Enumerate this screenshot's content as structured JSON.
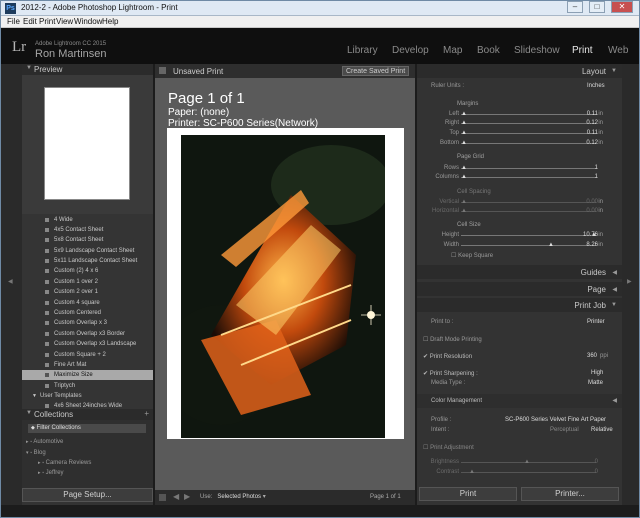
{
  "window": {
    "title": "2012-2 - Adobe Photoshop Lightroom - Print",
    "app_icon": "Ps"
  },
  "menu": [
    "File",
    "Edit",
    "Print",
    "View",
    "Window",
    "Help"
  ],
  "identity": {
    "logo": "Lr",
    "product": "Adobe Lightroom CC 2015",
    "owner": "Ron Martinsen"
  },
  "modules": [
    "Library",
    "Develop",
    "Map",
    "Book",
    "Slideshow",
    "Print",
    "Web"
  ],
  "active_module": "Print",
  "left": {
    "preview_title": "Preview",
    "templates": [
      "4 Wide",
      "4x5 Contact Sheet",
      "5x8 Contact Sheet",
      "5x9 Landscape Contact Sheet",
      "5x11 Landscape Contact Sheet",
      "Custom (2) 4 x 6",
      "Custom 1 over 2",
      "Custom 2 over 1",
      "Custom 4 square",
      "Custom Centered",
      "Custom Overlap x 3",
      "Custom Overlap x3 Border",
      "Custom Overlap x3 Landscape",
      "Custom Square + 2",
      "Fine Art Mat",
      "Maximize Size",
      "Triptych"
    ],
    "selected_template": "Maximize Size",
    "user_templates": "User Templates",
    "user_template_items": [
      "4x6 Sheet 24inches Wide"
    ],
    "collections_title": "Collections",
    "filter_collections": "Filter Collections",
    "collection_items": [
      "Automotive",
      "Blog",
      "Camera Reviews",
      "Jeffrey"
    ],
    "page_setup": "Page Setup..."
  },
  "center": {
    "header_title": "Unsaved Print",
    "create_saved": "Create Saved Print",
    "page_title": "Page 1 of 1",
    "paper": "Paper:  (none)",
    "printer": "Printer: SC-P600 Series(Network)",
    "use_label": "Use:",
    "use_value": "Selected Photos",
    "page_count": "Page 1 of 1"
  },
  "right": {
    "layout_title": "Layout",
    "ruler_units_label": "Ruler Units :",
    "ruler_units_value": "Inches",
    "margins_title": "Margins",
    "margins": [
      {
        "label": "Left",
        "value": "0.11",
        "unit": "in"
      },
      {
        "label": "Right",
        "value": "0.12",
        "unit": "in"
      },
      {
        "label": "Top",
        "value": "0.11",
        "unit": "in"
      },
      {
        "label": "Bottom",
        "value": "0.12",
        "unit": "in"
      }
    ],
    "page_grid_title": "Page Grid",
    "page_grid": [
      {
        "label": "Rows",
        "value": "1"
      },
      {
        "label": "Columns",
        "value": "1"
      }
    ],
    "cell_spacing_title": "Cell Spacing",
    "cell_spacing": [
      {
        "label": "Vertical",
        "value": "0.00",
        "unit": "in"
      },
      {
        "label": "Horizontal",
        "value": "0.00",
        "unit": "in"
      }
    ],
    "cell_size_title": "Cell Size",
    "cell_size": [
      {
        "label": "Height",
        "value": "10.76",
        "unit": "in"
      },
      {
        "label": "Width",
        "value": "8.26",
        "unit": "in"
      }
    ],
    "keep_square": "Keep Square",
    "guides_title": "Guides",
    "page_title": "Page",
    "print_job_title": "Print Job",
    "print_to_label": "Print to :",
    "print_to_value": "Printer",
    "draft_mode": "Draft Mode Printing",
    "print_resolution": "Print Resolution",
    "print_resolution_value": "360",
    "print_resolution_unit": "ppi",
    "print_sharpening": "Print Sharpening :",
    "print_sharpening_value": "High",
    "media_type_label": "Media Type :",
    "media_type_value": "Matte",
    "color_mgmt_title": "Color Management",
    "profile_label": "Profile :",
    "profile_value": "SC-P600 Series Velvet Fine Art Paper",
    "intent_label": "Intent :",
    "intent_perceptual": "Perceptual",
    "intent_relative": "Relative",
    "print_adjustment": "Print Adjustment",
    "brightness_label": "Brightness",
    "brightness_value": "0",
    "contrast_label": "Contrast",
    "contrast_value": "0",
    "print_button": "Print",
    "printer_button": "Printer..."
  }
}
